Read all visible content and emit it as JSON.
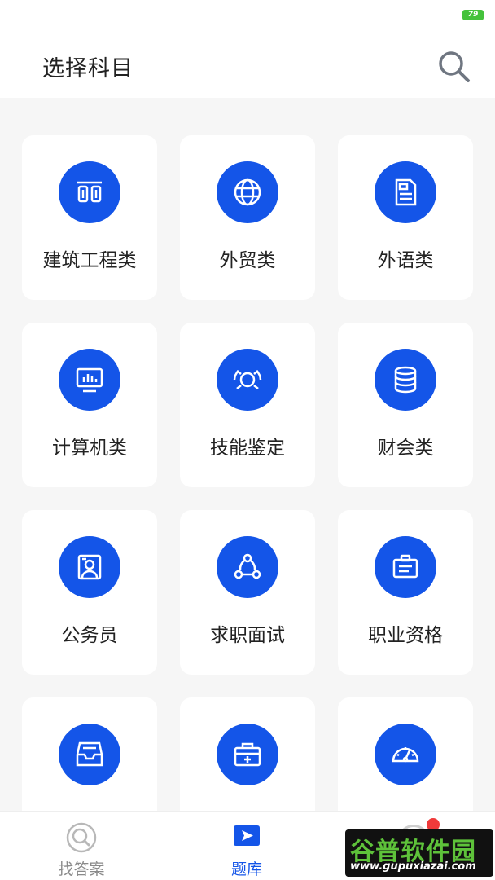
{
  "status_bar": {
    "battery": "79"
  },
  "header": {
    "title": "选择科目",
    "search_icon": "search-icon"
  },
  "categories": [
    {
      "label": "建筑工程类",
      "icon": "building-columns-icon"
    },
    {
      "label": "外贸类",
      "icon": "globe-icon"
    },
    {
      "label": "外语类",
      "icon": "document-icon"
    },
    {
      "label": "计算机类",
      "icon": "monitor-chart-icon"
    },
    {
      "label": "技能鉴定",
      "icon": "target-icon"
    },
    {
      "label": "财会类",
      "icon": "coin-stack-icon"
    },
    {
      "label": "公务员",
      "icon": "id-card-icon"
    },
    {
      "label": "求职面试",
      "icon": "network-icon"
    },
    {
      "label": "职业资格",
      "icon": "badge-icon"
    },
    {
      "label": "",
      "icon": "inbox-icon"
    },
    {
      "label": "",
      "icon": "medical-kit-icon"
    },
    {
      "label": "",
      "icon": "speedometer-icon"
    }
  ],
  "tabbar": {
    "tabs": [
      {
        "label": "找答案",
        "icon": "search-icon",
        "active": false
      },
      {
        "label": "题库",
        "icon": "play-flag-icon",
        "active": true
      }
    ]
  },
  "watermark": {
    "main": "谷普软件园",
    "sub": "www.gupuxiazai.com"
  },
  "colors": {
    "accent": "#1455e8",
    "background": "#f6f6f6",
    "badge": "#f03a3a"
  }
}
